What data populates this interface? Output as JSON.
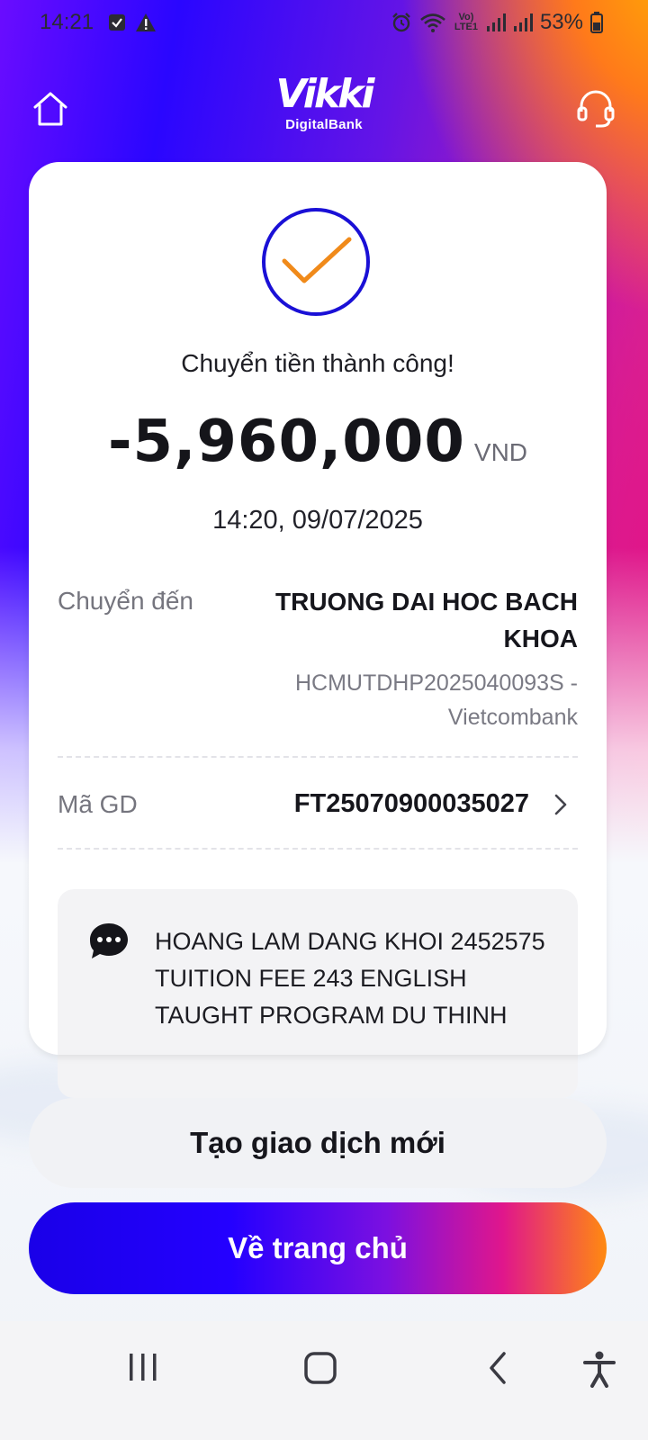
{
  "status_bar": {
    "time": "14:21",
    "battery": "53%",
    "network_label": "VoLTE1"
  },
  "header": {
    "logo_word": "Vikki",
    "logo_sub": "DigitalBank"
  },
  "transaction": {
    "status_text": "Chuyển tiền thành công!",
    "amount": "-5,960,000",
    "currency": "VND",
    "datetime": "14:20, 09/07/2025",
    "to_label": "Chuyển đến",
    "to_name": "TRUONG DAI HOC BACH KHOA",
    "to_account": "HCMUTDHP2025040093S - Vietcombank",
    "txid_label": "Mã GD",
    "txid": "FT25070900035027",
    "memo": "HOANG LAM DANG KHOI 2452575 TUITION FEE 243 ENGLISH TAUGHT PROGRAM DU THINH"
  },
  "actions": {
    "new_transaction": "Tạo giao dịch mới",
    "go_home": "Về trang chủ"
  },
  "colors": {
    "accent_blue": "#2400ff",
    "accent_orange": "#ff8a10",
    "check_ring": "#1a10d6",
    "check_mark": "#f08a1a"
  }
}
